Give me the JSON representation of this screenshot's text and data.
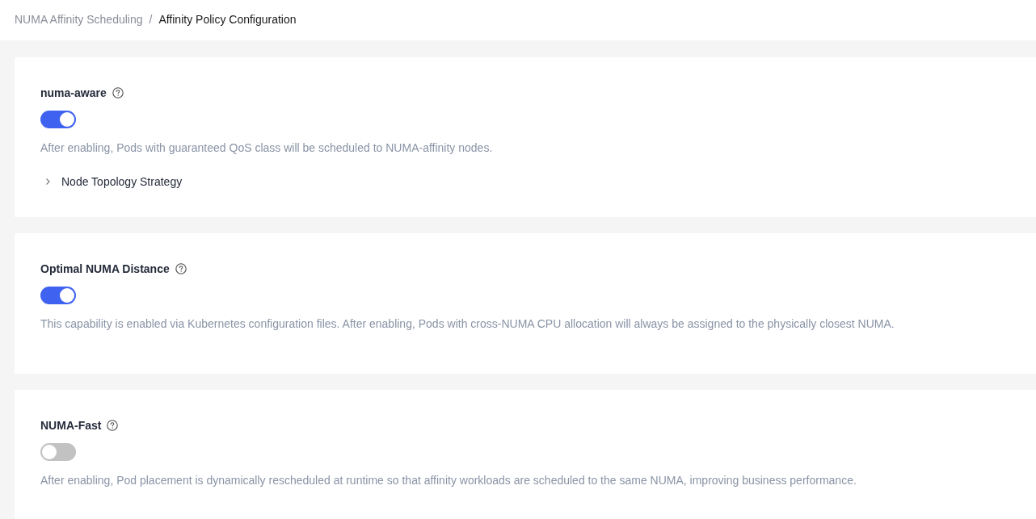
{
  "breadcrumb": {
    "separator": "/",
    "items": [
      {
        "label": "NUMA Affinity Scheduling",
        "current": false
      },
      {
        "label": "Affinity Policy Configuration",
        "current": true
      }
    ]
  },
  "sections": [
    {
      "title": "numa-aware",
      "enabled": true,
      "description": "After enabling, Pods with guaranteed QoS class will be scheduled to NUMA-affinity nodes.",
      "expander": {
        "label": "Node Topology Strategy",
        "expanded": false
      }
    },
    {
      "title": "Optimal NUMA Distance",
      "enabled": true,
      "description": "This capability is enabled via Kubernetes configuration files. After enabling, Pods with cross-NUMA CPU allocation will always be assigned to the physically closest NUMA."
    },
    {
      "title": "NUMA-Fast",
      "enabled": false,
      "description": "After enabling, Pod placement is dynamically rescheduled at runtime so that affinity workloads are scheduled to the same NUMA, improving business performance."
    }
  ]
}
